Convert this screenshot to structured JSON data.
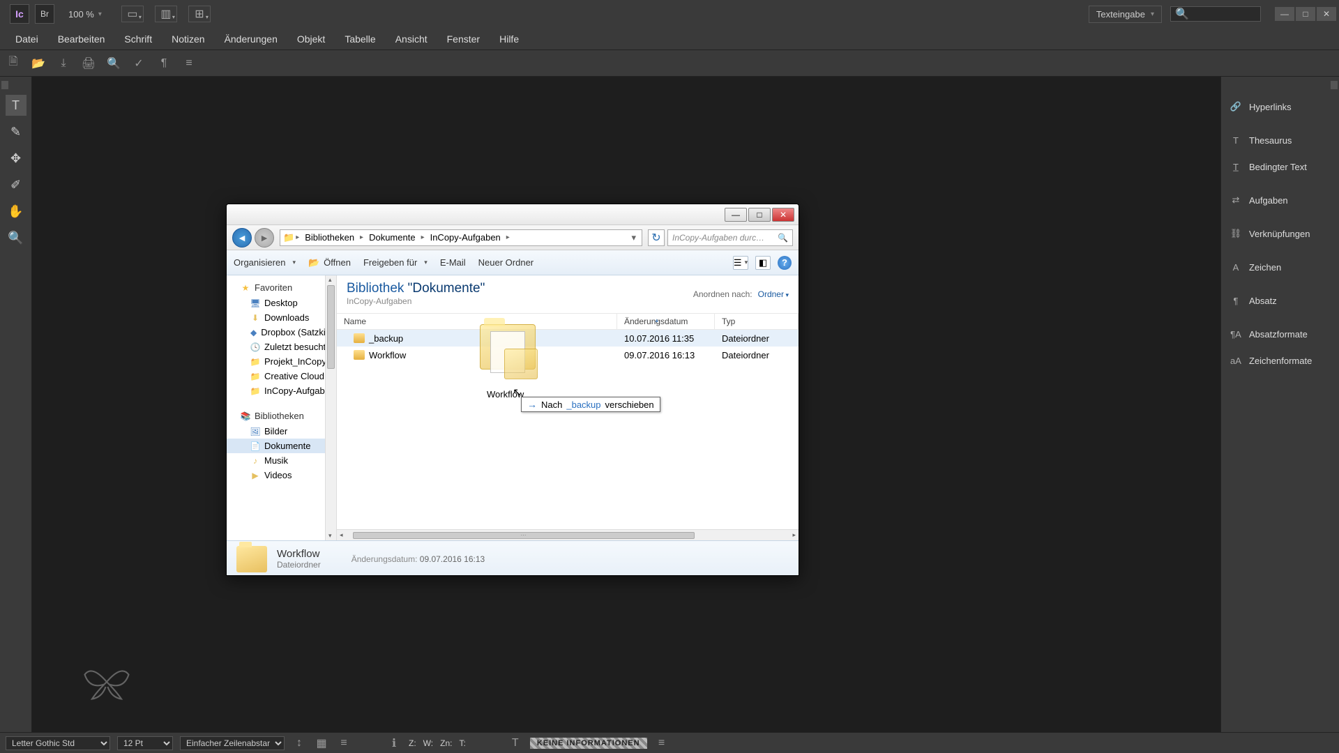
{
  "app": {
    "id_label": "Ic",
    "bridge_label": "Br",
    "zoom": "100 %"
  },
  "mode": {
    "label": "Texteingabe"
  },
  "window_controls": {
    "minimize": "—",
    "maximize": "□",
    "close": "✕"
  },
  "menu": [
    "Datei",
    "Bearbeiten",
    "Schrift",
    "Notizen",
    "Änderungen",
    "Objekt",
    "Tabelle",
    "Ansicht",
    "Fenster",
    "Hilfe"
  ],
  "tools": [
    {
      "name": "text-tool",
      "glyph": "T",
      "active": true
    },
    {
      "name": "note-tool",
      "glyph": "✎"
    },
    {
      "name": "position-tool",
      "glyph": "✥"
    },
    {
      "name": "eyedropper-tool",
      "glyph": "✐"
    },
    {
      "name": "hand-tool",
      "glyph": "✋"
    },
    {
      "name": "zoom-tool",
      "glyph": "🔍"
    }
  ],
  "panels": [
    {
      "label": "Hyperlinks",
      "icon": "🔗"
    },
    {
      "label": "Thesaurus",
      "icon": "T"
    },
    {
      "label": "Bedingter Text",
      "icon": "T̲"
    },
    {
      "label": "Aufgaben",
      "icon": "⇄"
    },
    {
      "label": "Verknüpfungen",
      "icon": "⛓"
    },
    {
      "label": "Zeichen",
      "icon": "A"
    },
    {
      "label": "Absatz",
      "icon": "¶"
    },
    {
      "label": "Absatzformate",
      "icon": "¶A"
    },
    {
      "label": "Zeichenformate",
      "icon": "aA"
    }
  ],
  "status": {
    "font": "Letter Gothic Std",
    "size": "12 Pt",
    "leading": "Einfacher Zeilenabstand",
    "labels": {
      "z": "Z:",
      "w": "W:",
      "zn": "Zn:",
      "t": "T:"
    },
    "info": "KEINE INFORMATIONEN"
  },
  "explorer": {
    "breadcrumb": [
      "Bibliotheken",
      "Dokumente",
      "InCopy-Aufgaben"
    ],
    "search_placeholder": "InCopy-Aufgaben durc…",
    "toolbar": {
      "organize": "Organisieren",
      "open": "Öffnen",
      "share": "Freigeben für",
      "email": "E-Mail",
      "new_folder": "Neuer Ordner"
    },
    "sidebar": {
      "favorites": {
        "label": "Favoriten",
        "items": [
          "Desktop",
          "Downloads",
          "Dropbox (Satzkist",
          "Zuletzt besucht",
          "Projekt_InCopy",
          "Creative Cloud File",
          "InCopy-Aufgaben"
        ]
      },
      "libraries": {
        "label": "Bibliotheken",
        "items": [
          "Bilder",
          "Dokumente",
          "Musik",
          "Videos"
        ],
        "selected": "Dokumente"
      }
    },
    "content": {
      "lib_title_prefix": "Bibliothek",
      "lib_title_name": "\"Dokumente\"",
      "lib_sub": "InCopy-Aufgaben",
      "sort_label": "Anordnen nach:",
      "sort_value": "Ordner",
      "columns": {
        "name": "Name",
        "date": "Änderungsdatum",
        "type": "Typ"
      },
      "rows": [
        {
          "name": "_backup",
          "date": "10.07.2016 11:35",
          "type": "Dateiordner",
          "highlight": true
        },
        {
          "name": "Workflow",
          "date": "09.07.2016 16:13",
          "type": "Dateiordner"
        }
      ]
    },
    "drag": {
      "ghost_label": "Workflow",
      "tooltip_prefix": "Nach",
      "tooltip_target": "_backup",
      "tooltip_suffix": "verschieben"
    },
    "details": {
      "name": "Workflow",
      "type": "Dateiordner",
      "meta_label": "Änderungsdatum:",
      "meta_value": "09.07.2016 16:13"
    }
  }
}
